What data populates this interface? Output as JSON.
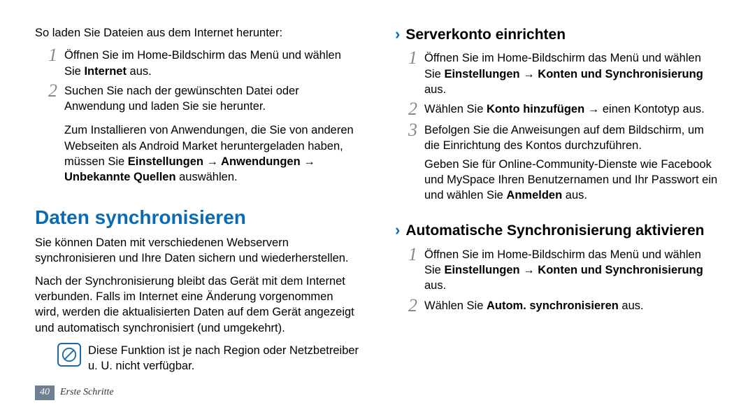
{
  "left": {
    "intro": "So laden Sie Dateien aus dem Internet herunter:",
    "step1_a": "Öffnen Sie im Home-Bildschirm das Menü und wählen Sie ",
    "step1_b": "Internet",
    "step1_c": " aus.",
    "step2": "Suchen Sie nach der gewünschten Datei oder Anwendung und laden Sie sie herunter.",
    "afterSteps_a": "Zum Installieren von Anwendungen, die Sie von anderen Webseiten als Android Market heruntergeladen haben, müssen Sie ",
    "afterSteps_b": "Einstellungen → Anwendungen → Unbekannte Quellen",
    "afterSteps_c": " auswählen.",
    "heading": "Daten synchronisieren",
    "p1": "Sie können Daten mit verschiedenen Webservern synchronisieren und Ihre Daten sichern und wiederherstellen.",
    "p2": "Nach der Synchronisierung bleibt das Gerät mit dem Internet verbunden. Falls im Internet eine Änderung vorgenommen wird, werden die aktualisierten Daten auf dem Gerät angezeigt und automatisch synchronisiert (und umgekehrt).",
    "note": "Diese Funktion ist je nach Region oder Netzbetreiber u. U. nicht verfügbar."
  },
  "right": {
    "sub1": "Serverkonto einrichten",
    "s1_step1_a": "Öffnen Sie im Home-Bildschirm das Menü und wählen Sie ",
    "s1_step1_b": "Einstellungen → Konten und Synchronisierung",
    "s1_step1_c": " aus.",
    "s1_step2_a": "Wählen Sie ",
    "s1_step2_b": "Konto hinzufügen",
    "s1_step2_c": " → einen Kontotyp aus.",
    "s1_step3": "Befolgen Sie die Anweisungen auf dem Bildschirm, um die Einrichtung des Kontos durchzuführen.",
    "s1_after_a": "Geben Sie für Online-Community-Dienste wie Facebook und MySpace Ihren Benutzernamen und Ihr Passwort ein und wählen Sie ",
    "s1_after_b": "Anmelden",
    "s1_after_c": " aus.",
    "sub2": "Automatische Synchronisierung aktivieren",
    "s2_step1_a": "Öffnen Sie im Home-Bildschirm das Menü und wählen Sie ",
    "s2_step1_b": "Einstellungen → Konten und Synchronisierung",
    "s2_step1_c": " aus.",
    "s2_step2_a": "Wählen Sie ",
    "s2_step2_b": "Autom. synchronisieren",
    "s2_step2_c": " aus."
  },
  "footer": {
    "page": "40",
    "section": "Erste Schritte"
  },
  "colors": {
    "headingBlue": "#0a6bb5",
    "footerBox": "#6d8094"
  }
}
